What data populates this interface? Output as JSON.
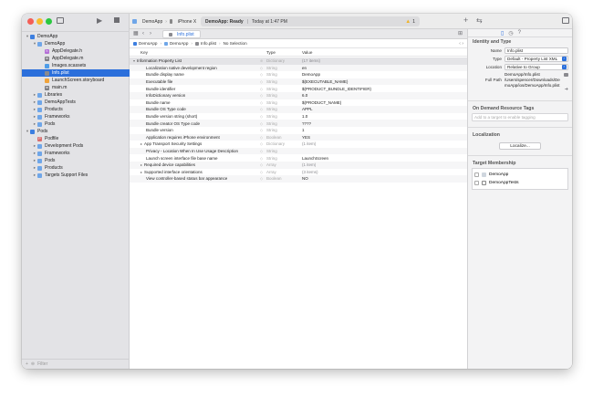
{
  "toolbar": {
    "scheme": "DemoApp",
    "device": "iPhone X",
    "status_bold": "DemoApp: Ready",
    "status_time": "Today at 1:47 PM",
    "warning_count": "1"
  },
  "navigator": {
    "items": [
      {
        "label": "DemoApp",
        "depth": 0,
        "open": true,
        "kind": "project",
        "selected": false
      },
      {
        "label": "DemoApp",
        "depth": 1,
        "open": true,
        "kind": "folder",
        "selected": false
      },
      {
        "label": "AppDelegate.h",
        "depth": 2,
        "open": null,
        "kind": "header",
        "selected": false
      },
      {
        "label": "AppDelegate.m",
        "depth": 2,
        "open": null,
        "kind": "source",
        "selected": false
      },
      {
        "label": "Images.xcassets",
        "depth": 2,
        "open": null,
        "kind": "assets",
        "selected": false
      },
      {
        "label": "Info.plist",
        "depth": 2,
        "open": null,
        "kind": "plist",
        "selected": true
      },
      {
        "label": "LaunchScreen.storyboard",
        "depth": 2,
        "open": null,
        "kind": "storyboard",
        "selected": false
      },
      {
        "label": "main.m",
        "depth": 2,
        "open": null,
        "kind": "source",
        "selected": false
      },
      {
        "label": "Libraries",
        "depth": 1,
        "open": false,
        "kind": "folder",
        "selected": false
      },
      {
        "label": "DemoAppTests",
        "depth": 1,
        "open": false,
        "kind": "folder",
        "selected": false
      },
      {
        "label": "Products",
        "depth": 1,
        "open": false,
        "kind": "folder",
        "selected": false
      },
      {
        "label": "Frameworks",
        "depth": 1,
        "open": false,
        "kind": "folder",
        "selected": false
      },
      {
        "label": "Pods",
        "depth": 1,
        "open": false,
        "kind": "folder",
        "selected": false
      },
      {
        "label": "Pods",
        "depth": 0,
        "open": true,
        "kind": "project",
        "selected": false
      },
      {
        "label": "Podfile",
        "depth": 1,
        "open": null,
        "kind": "podfile",
        "selected": false
      },
      {
        "label": "Development Pods",
        "depth": 1,
        "open": false,
        "kind": "folder",
        "selected": false
      },
      {
        "label": "Frameworks",
        "depth": 1,
        "open": false,
        "kind": "folder",
        "selected": false
      },
      {
        "label": "Pods",
        "depth": 1,
        "open": false,
        "kind": "folder",
        "selected": false
      },
      {
        "label": "Products",
        "depth": 1,
        "open": false,
        "kind": "folder",
        "selected": false
      },
      {
        "label": "Targets Support Files",
        "depth": 1,
        "open": false,
        "kind": "folder",
        "selected": false
      }
    ],
    "filter_placeholder": "Filter"
  },
  "editor": {
    "tab_label": "Info.plist",
    "jumpbar": [
      "DemoApp",
      "DemoApp",
      "Info.plist",
      "No Selection"
    ],
    "columns": {
      "key": "Key",
      "type": "Type",
      "value": "Value"
    },
    "rows": [
      {
        "key": "Information Property List",
        "type": "Dictionary",
        "value": "(17 items)",
        "indent": 0,
        "disclosure": "open",
        "root": true
      },
      {
        "key": "Localization native development region",
        "type": "String",
        "value": "en",
        "indent": 1,
        "disclosure": "",
        "root": false
      },
      {
        "key": "Bundle display name",
        "type": "String",
        "value": "DemoApp",
        "indent": 1,
        "disclosure": "",
        "root": false
      },
      {
        "key": "Executable file",
        "type": "String",
        "value": "$(EXECUTABLE_NAME)",
        "indent": 1,
        "disclosure": "",
        "root": false
      },
      {
        "key": "Bundle identifier",
        "type": "String",
        "value": "$(PRODUCT_BUNDLE_IDENTIFIER)",
        "indent": 1,
        "disclosure": "",
        "root": false
      },
      {
        "key": "InfoDictionary version",
        "type": "String",
        "value": "6.0",
        "indent": 1,
        "disclosure": "",
        "root": false
      },
      {
        "key": "Bundle name",
        "type": "String",
        "value": "$(PRODUCT_NAME)",
        "indent": 1,
        "disclosure": "",
        "root": false
      },
      {
        "key": "Bundle OS Type code",
        "type": "String",
        "value": "APPL",
        "indent": 1,
        "disclosure": "",
        "root": false
      },
      {
        "key": "Bundle version string (short)",
        "type": "String",
        "value": "1.0",
        "indent": 1,
        "disclosure": "",
        "root": false
      },
      {
        "key": "Bundle creator OS Type code",
        "type": "String",
        "value": "????",
        "indent": 1,
        "disclosure": "",
        "root": false
      },
      {
        "key": "Bundle version",
        "type": "String",
        "value": "1",
        "indent": 1,
        "disclosure": "",
        "root": false
      },
      {
        "key": "Application requires iPhone environment",
        "type": "Boolean",
        "value": "YES",
        "indent": 1,
        "disclosure": "",
        "root": false
      },
      {
        "key": "App Transport Security Settings",
        "type": "Dictionary",
        "value": "(1 item)",
        "indent": 1,
        "disclosure": "closed",
        "root": false
      },
      {
        "key": "Privacy - Location When In Use Usage Description",
        "type": "String",
        "value": "",
        "indent": 1,
        "disclosure": "",
        "root": false
      },
      {
        "key": "Launch screen interface file base name",
        "type": "String",
        "value": "LaunchScreen",
        "indent": 1,
        "disclosure": "",
        "root": false
      },
      {
        "key": "Required device capabilities",
        "type": "Array",
        "value": "(1 item)",
        "indent": 1,
        "disclosure": "closed",
        "root": false
      },
      {
        "key": "Supported interface orientations",
        "type": "Array",
        "value": "(3 items)",
        "indent": 1,
        "disclosure": "closed",
        "root": false
      },
      {
        "key": "View controller-based status bar appearance",
        "type": "Boolean",
        "value": "NO",
        "indent": 1,
        "disclosure": "",
        "root": false
      }
    ]
  },
  "inspector": {
    "identity_title": "Identity and Type",
    "name_label": "Name",
    "name_value": "Info.plist",
    "type_label": "Type",
    "type_value": "Default - Property List XML",
    "location_label": "Location",
    "location_value": "Relative to Group",
    "location_path": "DemoApp/Info.plist",
    "fullpath_label": "Full Path",
    "fullpath_value": "/Users/spencer/Downloads/DemoApp/ios/DemoApp/Info.plist",
    "odr_title": "On Demand Resource Tags",
    "odr_placeholder": "Add to a target to enable tagging",
    "loc_title": "Localization",
    "localize_button": "Localize...",
    "target_title": "Target Membership",
    "targets": [
      "DemoApp",
      "DemoAppTests"
    ]
  },
  "colors": {
    "selection": "#2b6fdb",
    "folder": "#6fa6e8",
    "warning": "#f0b429"
  }
}
